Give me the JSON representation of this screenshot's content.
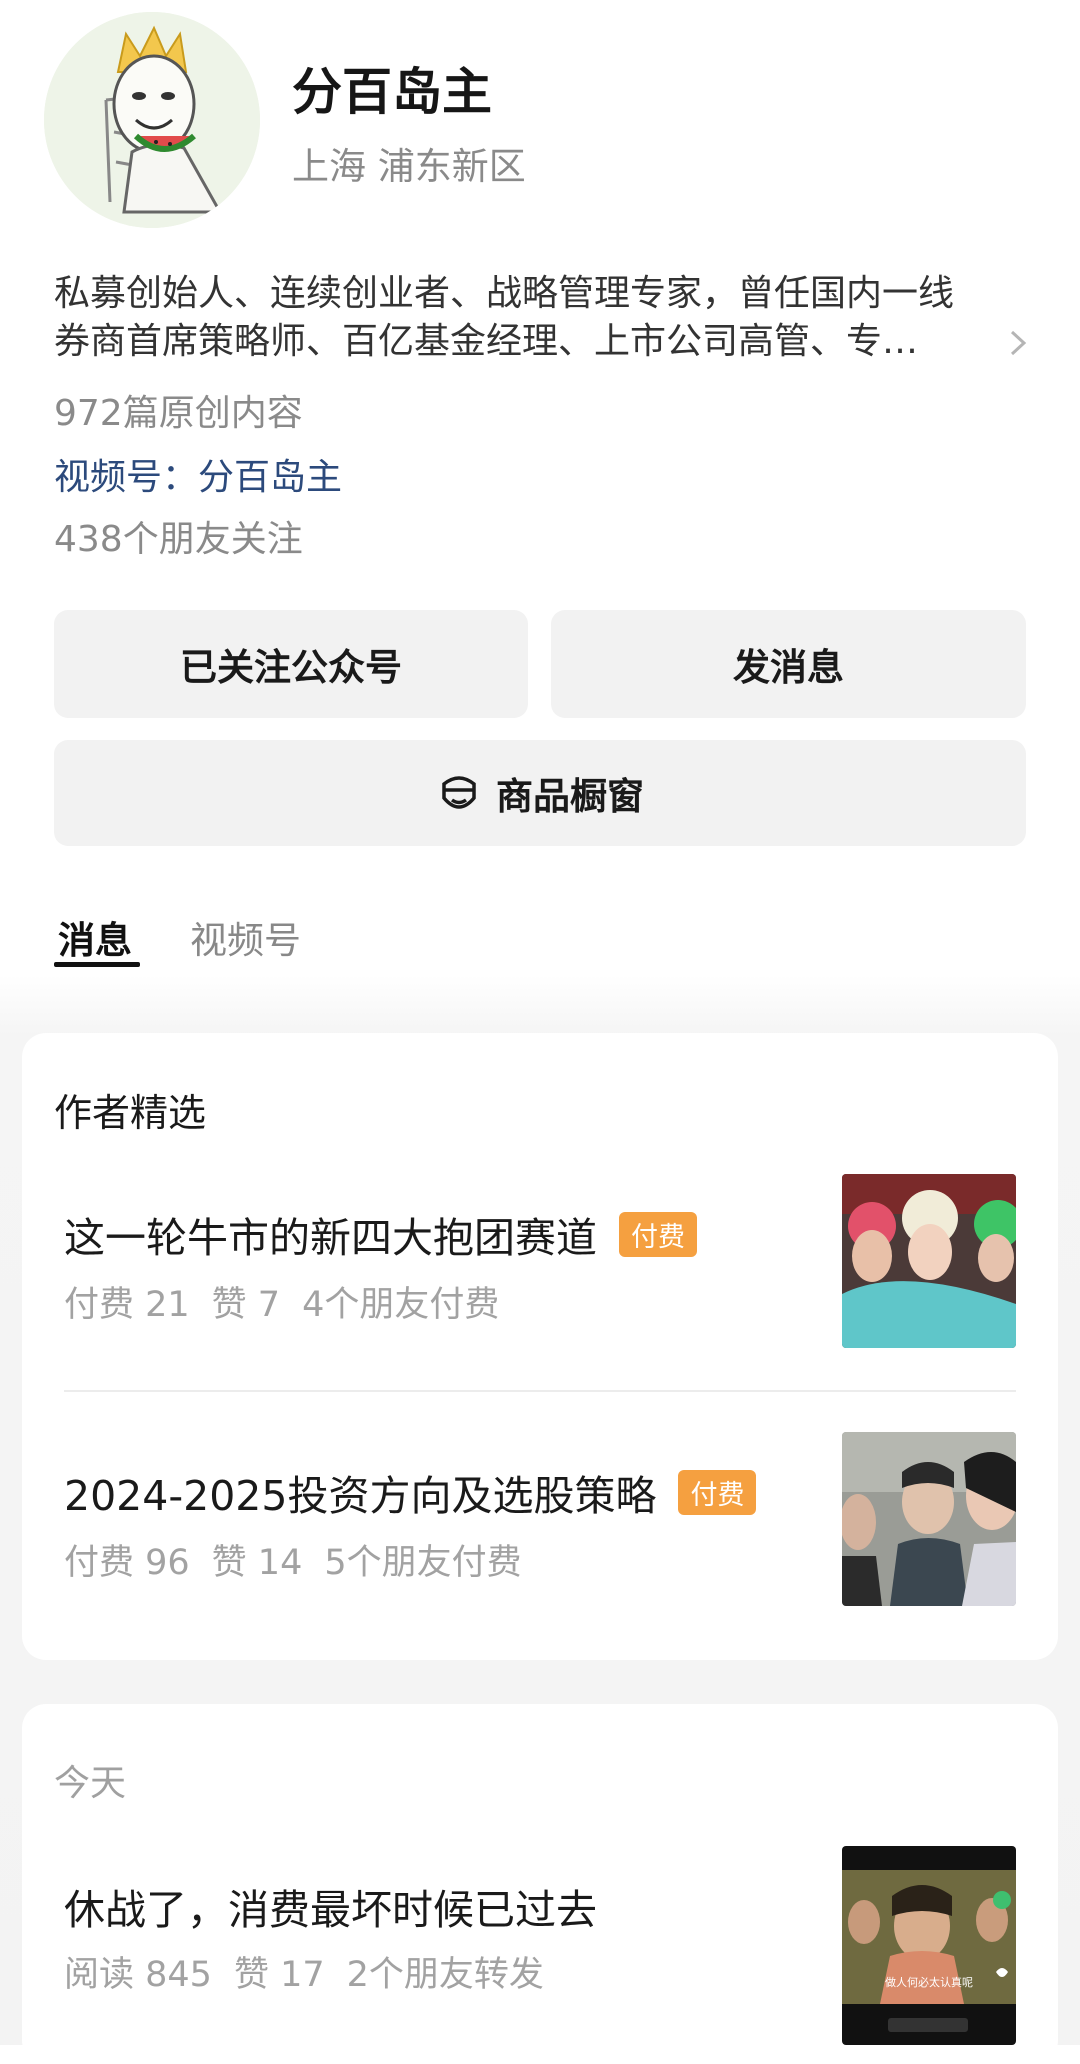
{
  "profile": {
    "name": "分百岛主",
    "region": "上海 浦东新区",
    "bio_line1": "私募创始人、连续创业者、战略管理专家，曾任国内一线",
    "bio_line2": "券商首席策略师、百亿基金经理、上市公司高管、专…",
    "original_count": "972篇原创内容",
    "channel": "视频号：分百岛主",
    "friends_follow": "438个朋友关注"
  },
  "actions": {
    "follow_label": "已关注公众号",
    "message_label": "发消息",
    "shop_label": "商品橱窗"
  },
  "tabs": [
    {
      "label": "消息",
      "active": true
    },
    {
      "label": "视频号",
      "active": false
    }
  ],
  "featured": {
    "title": "作者精选",
    "articles": [
      {
        "title": "这一轮牛市的新四大抱团赛道",
        "badge": "付费",
        "paid": "付费 21",
        "likes": "赞 7",
        "friends": "4个朋友付费"
      },
      {
        "title": "2024-2025投资方向及选股策略",
        "badge": "付费",
        "paid": "付费 96",
        "likes": "赞 14",
        "friends": "5个朋友付费"
      }
    ]
  },
  "today": {
    "label": "今天",
    "articles": [
      {
        "title": "休战了，消费最坏时候已过去",
        "reads": "阅读 845",
        "likes": "赞 17",
        "friends": "2个朋友转发",
        "thumb_caption": "做人何必太认真呢"
      }
    ]
  },
  "colors": {
    "badge": "#f5a040",
    "link": "#2c4a7c",
    "muted": "#8a8a8a"
  }
}
